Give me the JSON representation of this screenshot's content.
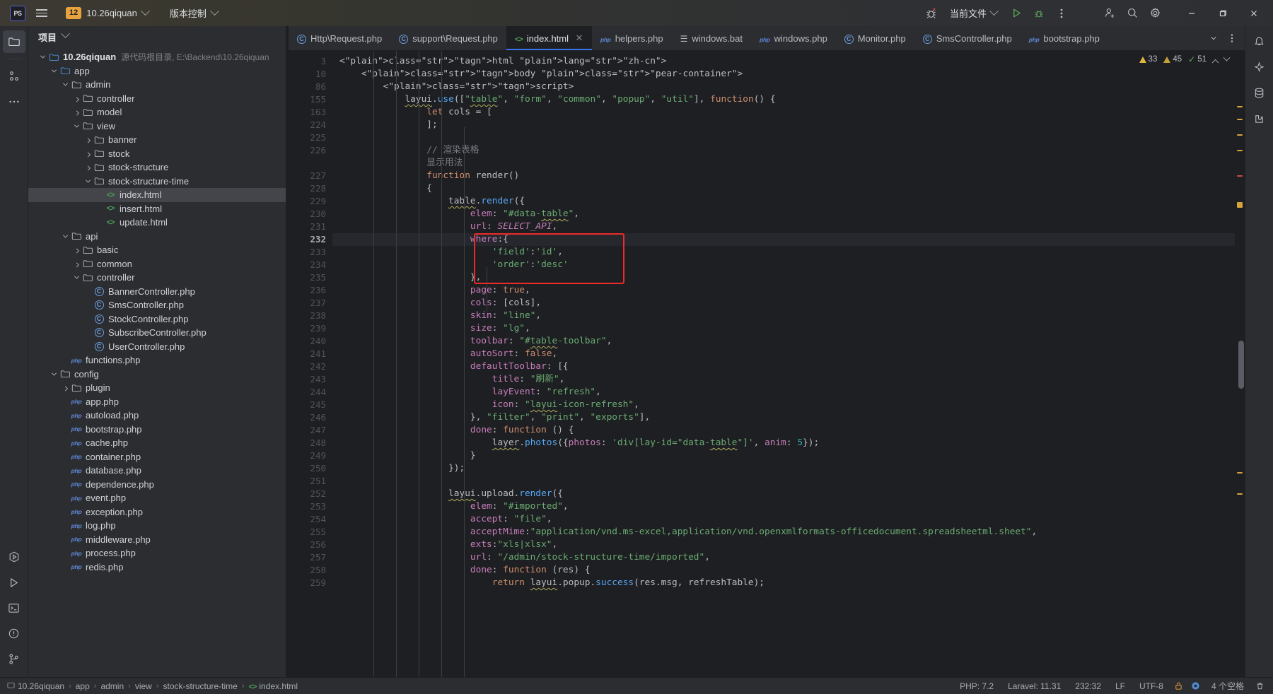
{
  "titlebar": {
    "logo": "PS",
    "menu_icon": "hamburger-menu-icon",
    "project_badge": "12",
    "project_name": "10.26qiquan",
    "vcs_label": "版本控制",
    "run_config": "当前文件",
    "icons": {
      "debug_error": "bug-error-icon",
      "run": "run-icon",
      "debug": "debug-icon",
      "more": "more-vertical-icon",
      "share": "add-user-icon",
      "search": "search-icon",
      "settings": "gear-icon",
      "minimize": "minimize-icon",
      "maximize": "maximize-icon",
      "close": "close-icon"
    }
  },
  "left_toolstrip": [
    {
      "name": "project-tool-icon",
      "glyph": "folder"
    },
    {
      "name": "structure-tool-icon",
      "glyph": "structure"
    },
    {
      "name": "more-tool-icon",
      "glyph": "dots"
    },
    {
      "name": "run-tool-icon",
      "glyph": "run-circle"
    },
    {
      "name": "debug-tool-icon",
      "glyph": "play"
    },
    {
      "name": "terminal-tool-icon",
      "glyph": "terminal"
    },
    {
      "name": "problems-tool-icon",
      "glyph": "warning-circle"
    },
    {
      "name": "vcs-tool-icon",
      "glyph": "branch"
    }
  ],
  "right_toolstrip": [
    {
      "name": "notifications-icon",
      "glyph": "bell"
    },
    {
      "name": "ai-assistant-icon",
      "glyph": "ai"
    },
    {
      "name": "database-icon",
      "glyph": "db"
    },
    {
      "name": "plugins-icon",
      "glyph": "plug"
    }
  ],
  "project_panel": {
    "title": "项目",
    "tree": [
      {
        "depth": 0,
        "arrow": "down",
        "icon": "folder-blue",
        "label": "10.26qiquan",
        "bold": true,
        "sub": "源代码根目录, E:\\Backend\\10.26qiquan"
      },
      {
        "depth": 1,
        "arrow": "down",
        "icon": "folder-blue",
        "label": "app"
      },
      {
        "depth": 2,
        "arrow": "down",
        "icon": "folder",
        "label": "admin"
      },
      {
        "depth": 3,
        "arrow": "right",
        "icon": "folder",
        "label": "controller"
      },
      {
        "depth": 3,
        "arrow": "right",
        "icon": "folder",
        "label": "model"
      },
      {
        "depth": 3,
        "arrow": "down",
        "icon": "folder",
        "label": "view"
      },
      {
        "depth": 4,
        "arrow": "right",
        "icon": "folder",
        "label": "banner"
      },
      {
        "depth": 4,
        "arrow": "right",
        "icon": "folder",
        "label": "stock"
      },
      {
        "depth": 4,
        "arrow": "right",
        "icon": "folder",
        "label": "stock-structure"
      },
      {
        "depth": 4,
        "arrow": "down",
        "icon": "folder",
        "label": "stock-structure-time"
      },
      {
        "depth": 5,
        "arrow": "none",
        "icon": "html",
        "label": "index.html",
        "selected": true
      },
      {
        "depth": 5,
        "arrow": "none",
        "icon": "html",
        "label": "insert.html"
      },
      {
        "depth": 5,
        "arrow": "none",
        "icon": "html",
        "label": "update.html"
      },
      {
        "depth": 2,
        "arrow": "down",
        "icon": "folder",
        "label": "api"
      },
      {
        "depth": 3,
        "arrow": "right",
        "icon": "folder",
        "label": "basic"
      },
      {
        "depth": 3,
        "arrow": "right",
        "icon": "folder",
        "label": "common"
      },
      {
        "depth": 3,
        "arrow": "down",
        "icon": "folder",
        "label": "controller"
      },
      {
        "depth": 4,
        "arrow": "none",
        "icon": "class",
        "label": "BannerController.php"
      },
      {
        "depth": 4,
        "arrow": "none",
        "icon": "class",
        "label": "SmsController.php"
      },
      {
        "depth": 4,
        "arrow": "none",
        "icon": "class",
        "label": "StockController.php"
      },
      {
        "depth": 4,
        "arrow": "none",
        "icon": "class",
        "label": "SubscribeController.php"
      },
      {
        "depth": 4,
        "arrow": "none",
        "icon": "class",
        "label": "UserController.php"
      },
      {
        "depth": 2,
        "arrow": "none",
        "icon": "php",
        "label": "functions.php"
      },
      {
        "depth": 1,
        "arrow": "down",
        "icon": "folder",
        "label": "config"
      },
      {
        "depth": 2,
        "arrow": "right",
        "icon": "folder",
        "label": "plugin"
      },
      {
        "depth": 2,
        "arrow": "none",
        "icon": "php",
        "label": "app.php"
      },
      {
        "depth": 2,
        "arrow": "none",
        "icon": "php",
        "label": "autoload.php"
      },
      {
        "depth": 2,
        "arrow": "none",
        "icon": "php",
        "label": "bootstrap.php"
      },
      {
        "depth": 2,
        "arrow": "none",
        "icon": "php",
        "label": "cache.php"
      },
      {
        "depth": 2,
        "arrow": "none",
        "icon": "php",
        "label": "container.php"
      },
      {
        "depth": 2,
        "arrow": "none",
        "icon": "php",
        "label": "database.php"
      },
      {
        "depth": 2,
        "arrow": "none",
        "icon": "php",
        "label": "dependence.php"
      },
      {
        "depth": 2,
        "arrow": "none",
        "icon": "php",
        "label": "event.php"
      },
      {
        "depth": 2,
        "arrow": "none",
        "icon": "php",
        "label": "exception.php"
      },
      {
        "depth": 2,
        "arrow": "none",
        "icon": "php",
        "label": "log.php"
      },
      {
        "depth": 2,
        "arrow": "none",
        "icon": "php",
        "label": "middleware.php"
      },
      {
        "depth": 2,
        "arrow": "none",
        "icon": "php",
        "label": "process.php"
      },
      {
        "depth": 2,
        "arrow": "none",
        "icon": "php",
        "label": "redis.php"
      }
    ]
  },
  "tabs": [
    {
      "label": "Http\\Request.php",
      "icon": "class",
      "active": false,
      "closable": false
    },
    {
      "label": "support\\Request.php",
      "icon": "class",
      "active": false,
      "closable": false
    },
    {
      "label": "index.html",
      "icon": "html",
      "active": true,
      "closable": true
    },
    {
      "label": "helpers.php",
      "icon": "php",
      "active": false,
      "closable": false
    },
    {
      "label": "windows.bat",
      "icon": "bat",
      "active": false,
      "closable": false
    },
    {
      "label": "windows.php",
      "icon": "php",
      "active": false,
      "closable": false
    },
    {
      "label": "Monitor.php",
      "icon": "class",
      "active": false,
      "closable": false
    },
    {
      "label": "SmsController.php",
      "icon": "class",
      "active": false,
      "closable": false
    },
    {
      "label": "bootstrap.php",
      "icon": "php",
      "active": false,
      "closable": false
    }
  ],
  "tabbar_right_icons": [
    "chevron-down-icon",
    "more-vertical-icon"
  ],
  "inspection": {
    "errors": "33",
    "warnings": "45",
    "checks": "51",
    "up_icon": "chevron-up-icon",
    "down_icon": "chevron-down-icon"
  },
  "editor": {
    "line_numbers": [
      "3",
      "10",
      "86",
      "155",
      "163",
      "224",
      "225",
      "226",
      "",
      "227",
      "228",
      "229",
      "230",
      "231",
      "232",
      "233",
      "234",
      "235",
      "236",
      "237",
      "238",
      "239",
      "240",
      "241",
      "242",
      "243",
      "244",
      "245",
      "246",
      "247",
      "248",
      "249",
      "250",
      "251",
      "252",
      "253",
      "254",
      "255",
      "256",
      "257",
      "258",
      "259"
    ],
    "current_line": "232",
    "code_lines": [
      "<html lang=\"zh-cn\">",
      "    <body class=\"pear-container\">",
      "        <script>",
      "            layui.use([\"table\", \"form\", \"common\", \"popup\", \"util\"], function() {",
      "                let cols = [",
      "                ];",
      "",
      "                // 渲染表格",
      "                显示用法",
      "                function render()",
      "                {",
      "                    table.render({",
      "                        elem: \"#data-table\",",
      "                        url: SELECT_API,",
      "                        where:{",
      "                            'field':'id',",
      "                            'order':'desc'",
      "                        },",
      "                        page: true,",
      "                        cols: [cols],",
      "                        skin: \"line\",",
      "                        size: \"lg\",",
      "                        toolbar: \"#table-toolbar\",",
      "                        autoSort: false,",
      "                        defaultToolbar: [{",
      "                            title: \"刷新\",",
      "                            layEvent: \"refresh\",",
      "                            icon: \"layui-icon-refresh\",",
      "                        }, \"filter\", \"print\", \"exports\"],",
      "                        done: function () {",
      "                            layer.photos({photos: 'div[lay-id=\"data-table\"]', anim: 5});",
      "                        }",
      "                    });",
      "",
      "                    layui.upload.render({",
      "                        elem: \"#imported\",",
      "                        accept: \"file\",",
      "                        acceptMime:\"application/vnd.ms-excel,application/vnd.openxmlformats-officedocument.spreadsheetml.sheet\",",
      "                        exts:\"xls|xlsx\",",
      "                        url: \"/admin/stock-structure-time/imported\",",
      "                        done: function (res) {",
      "                            return layui.popup.success(res.msg, refreshTable);"
    ]
  },
  "highlight_box": {
    "color": "#ee2b2b",
    "content": [
      "where:{",
      "    'field':'id',",
      "    'order':'desc'",
      "},"
    ]
  },
  "statusbar": {
    "breadcrumb": [
      {
        "label": "10.26qiquan",
        "icon": "project-icon"
      },
      {
        "label": "app"
      },
      {
        "label": "admin"
      },
      {
        "label": "view"
      },
      {
        "label": "stock-structure-time"
      },
      {
        "label": "index.html",
        "icon": "html"
      }
    ],
    "php_version": "PHP: 7.2",
    "framework": "Laravel: 11.31",
    "caret": "232:32",
    "line_sep": "LF",
    "encoding": "UTF-8",
    "indent": "4 个空格",
    "icons": [
      "lock-icon",
      "ide-icon",
      "trash-icon"
    ]
  }
}
